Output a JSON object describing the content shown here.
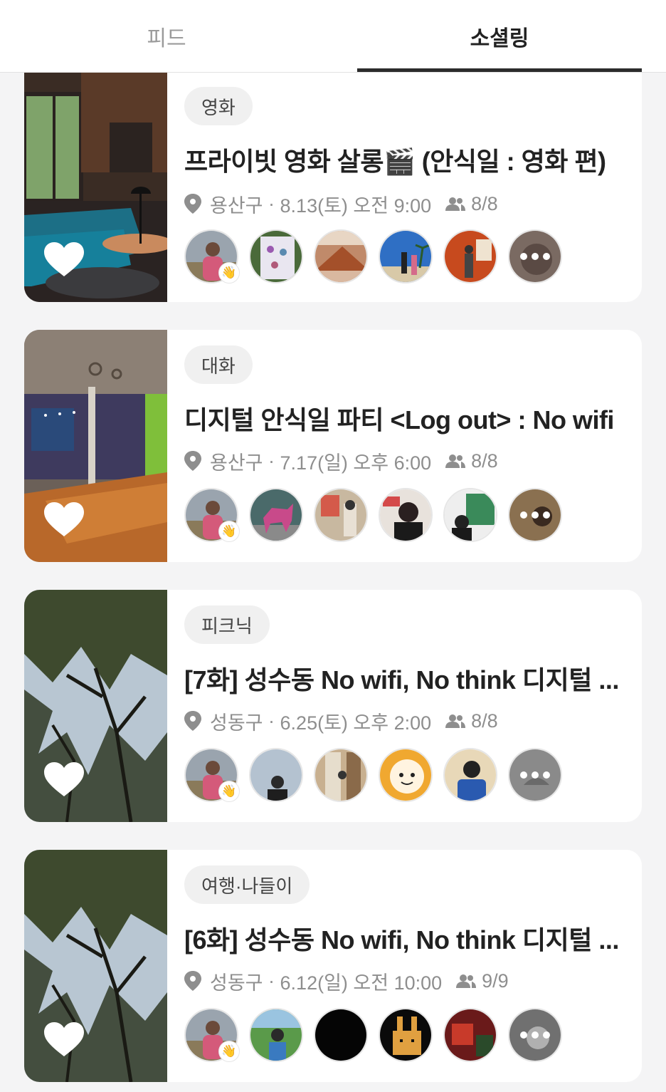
{
  "tabs": [
    {
      "label": "피드",
      "active": false
    },
    {
      "label": "소셜링",
      "active": true
    }
  ],
  "colors": {
    "active_tab": "#222222",
    "inactive_tab": "#9b9b9b",
    "background": "#f4f4f5"
  },
  "icons": {
    "location": "location-pin-icon",
    "members": "people-icon",
    "like": "heart-icon",
    "wave": "👋",
    "more": "more-members-icon"
  },
  "cards": [
    {
      "category": "영화",
      "title": "프라이빗 영화 살롱🎬 (안식일 : 영화 편)",
      "location": "용산구",
      "datetime": "8.13(토) 오전 9:00",
      "members": "8/8"
    },
    {
      "category": "대화",
      "title": "디지털 안식일 파티 <Log out> : No wifi",
      "location": "용산구",
      "datetime": "7.17(일) 오후 6:00",
      "members": "8/8"
    },
    {
      "category": "피크닉",
      "title": "[7화] 성수동 No wifi, No think 디지털 ...",
      "location": "성동구",
      "datetime": "6.25(토) 오후 2:00",
      "members": "8/8"
    },
    {
      "category": "여행·나들이",
      "title": "[6화] 성수동 No wifi, No think 디지털 ...",
      "location": "성동구",
      "datetime": "6.12(일) 오전 10:00",
      "members": "9/9"
    }
  ]
}
